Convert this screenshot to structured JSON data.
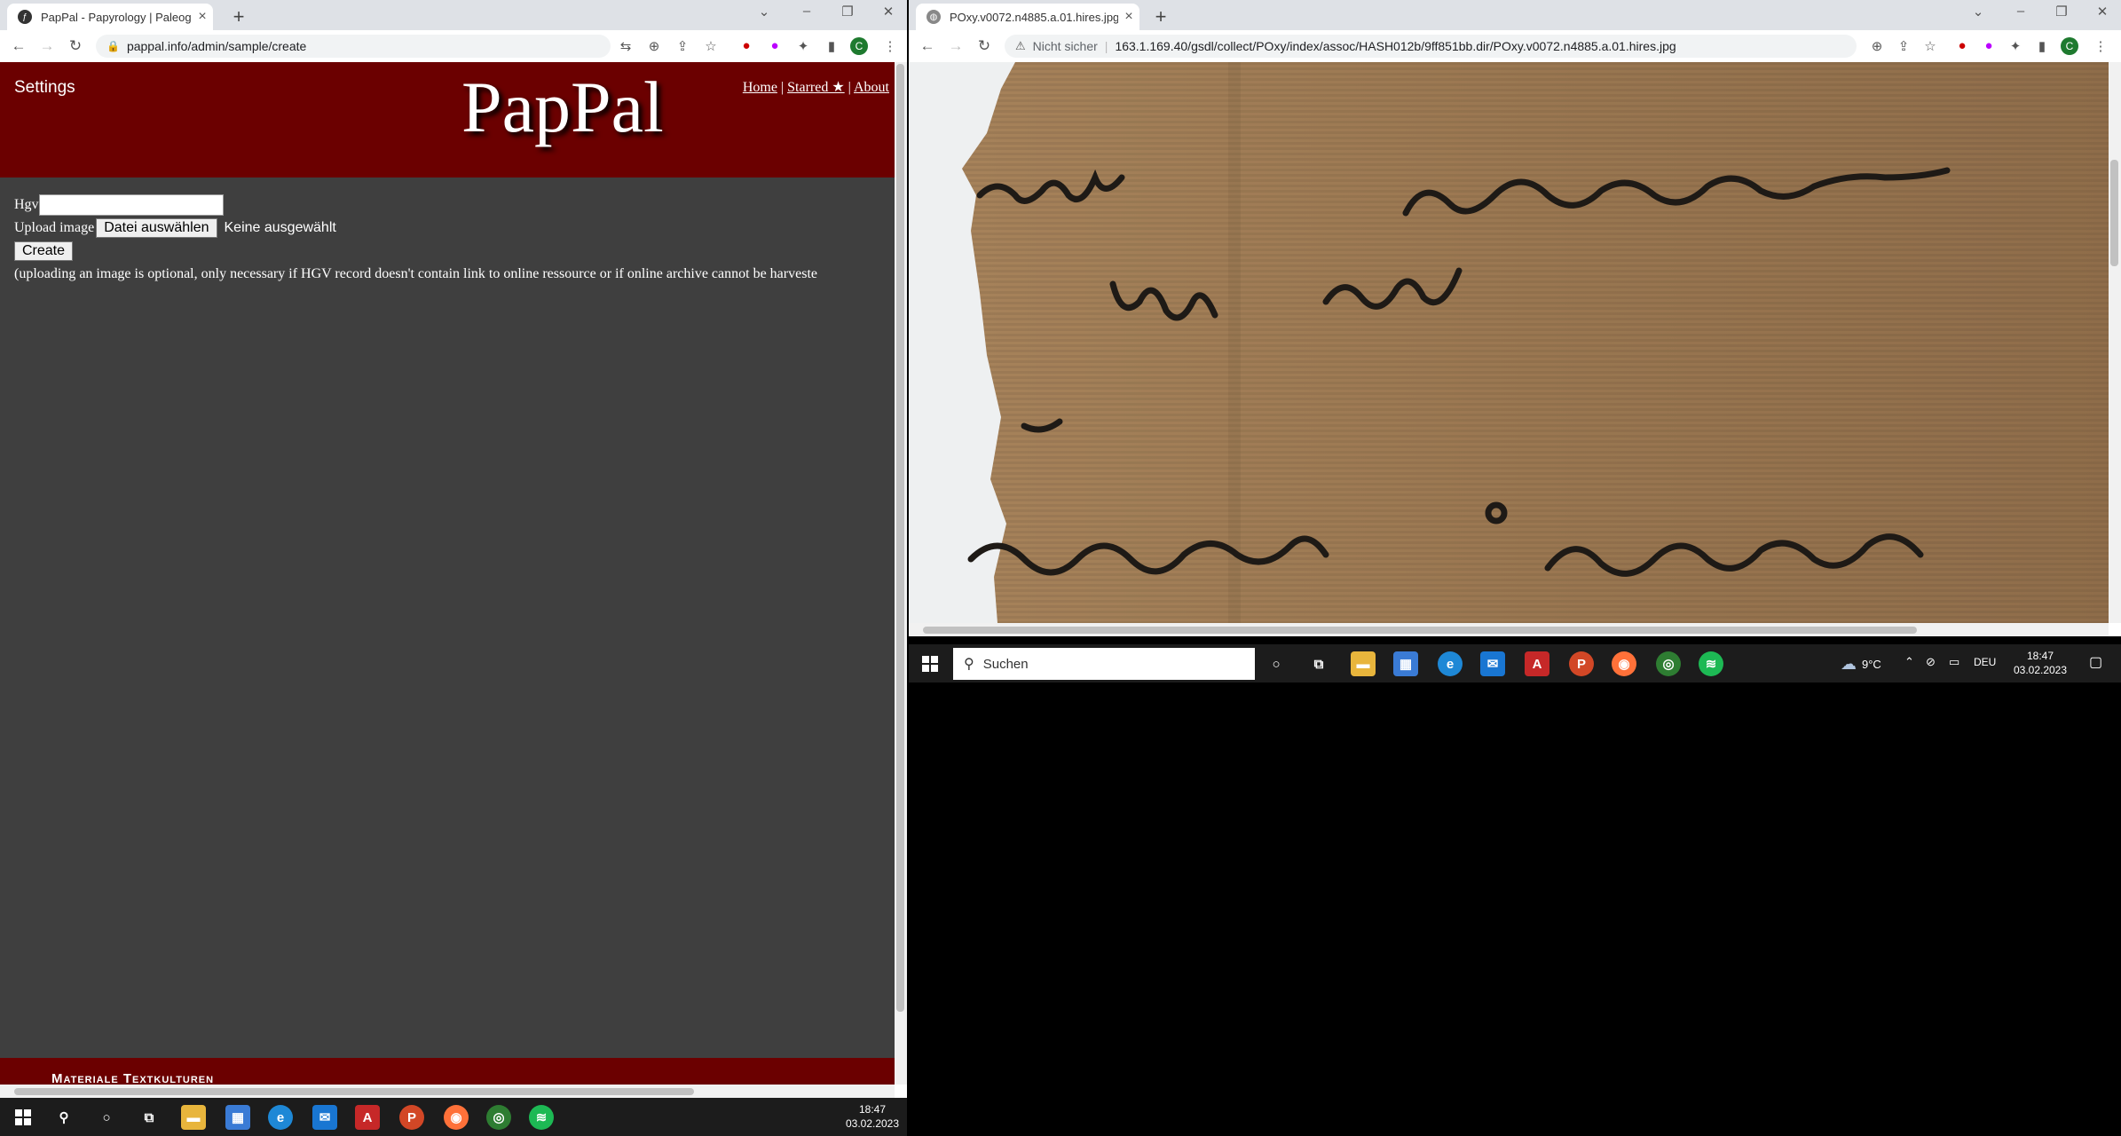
{
  "left_browser": {
    "tab_title": "PapPal - Papyrology | Paleograph",
    "url": "pappal.info/admin/sample/create",
    "page": {
      "settings_label": "Settings",
      "logo": "PapPal",
      "nav": {
        "home": "Home",
        "starred": "Starred ★",
        "about": "About",
        "sep": "|"
      },
      "hgv_label": "Hgv",
      "hgv_value": "",
      "upload_label": "Upload image",
      "file_button": "Datei auswählen",
      "file_status": "Keine ausgewählt",
      "create_button": "Create",
      "note": "(uploading an image is optional, only necessary if HGV record doesn't contain link to online ressource or if online archive cannot be harveste",
      "footer_text": "Materiale Textkulturen"
    }
  },
  "right_browser": {
    "tab_title": "POxy.v0072.n4885.a.01.hires.jpg",
    "security_label": "Nicht sicher",
    "url": "163.1.169.40/gsdl/collect/POxy/index/assoc/HASH012b/9ff851bb.dir/POxy.v0072.n4885.a.01.hires.jpg"
  },
  "taskbar_right": {
    "search_placeholder": "Suchen",
    "weather": "9°C",
    "language": "DEU",
    "time": "18:47",
    "date": "03.02.2023"
  },
  "taskbar_left": {
    "time": "18:47",
    "date": "03.02.2023"
  },
  "colors": {
    "header_bg": "#6b0000",
    "page_bg": "#3f3f3f",
    "papyrus": "#9c7b56"
  }
}
